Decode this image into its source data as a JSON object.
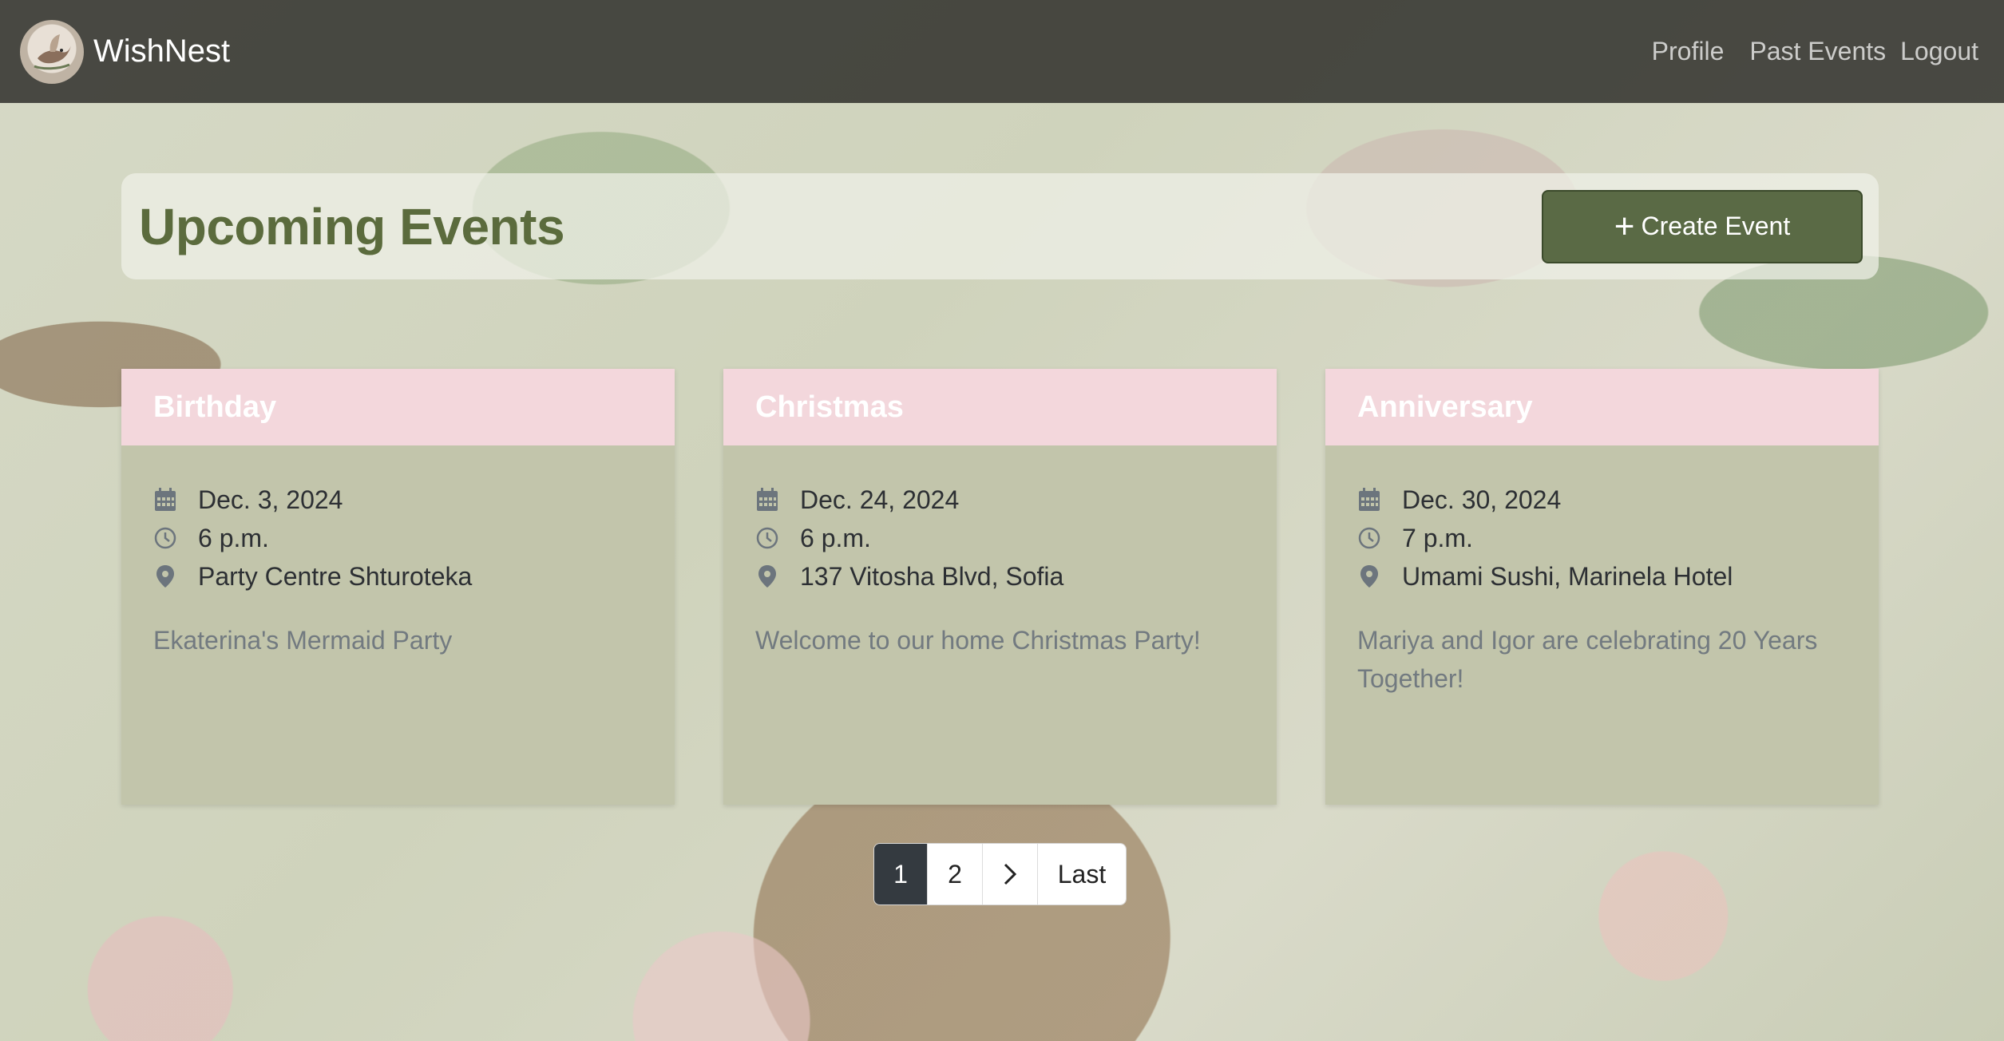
{
  "app": {
    "name": "WishNest"
  },
  "nav": {
    "links": [
      {
        "label": "Profile"
      },
      {
        "label": "Past Events"
      },
      {
        "label": "Logout"
      }
    ]
  },
  "page": {
    "title": "Upcoming Events",
    "create_button": {
      "icon": "plus-icon",
      "label": "Create Event"
    }
  },
  "events": [
    {
      "title": "Birthday",
      "date": "Dec. 3, 2024",
      "time": "6 p.m.",
      "location": "Party Centre Shturoteka",
      "description": "Ekaterina's Mermaid Party"
    },
    {
      "title": "Christmas",
      "date": "Dec. 24, 2024",
      "time": "6 p.m.",
      "location": "137 Vitosha Blvd, Sofia",
      "description": "Welcome to our home Christmas Party!"
    },
    {
      "title": "Anniversary",
      "date": "Dec. 30, 2024",
      "time": "7 p.m.",
      "location": "Umami Sushi, Marinela Hotel",
      "description": "Mariya and Igor are celebrating 20 Years Together!"
    }
  ],
  "pagination": {
    "pages": [
      "1",
      "2"
    ],
    "current": "1",
    "next_icon": "chevron-right-icon",
    "last_label": "Last"
  },
  "colors": {
    "navbar": "#282824",
    "title_green": "#5b6b3d",
    "button_green": "#5a6a45",
    "card_header_pink": "#f3d7dc",
    "card_body": "#c2c5ab",
    "pagination_active": "#343a40"
  },
  "icons": {
    "date": "calendar-icon",
    "time": "clock-icon",
    "location": "map-pin-icon"
  }
}
